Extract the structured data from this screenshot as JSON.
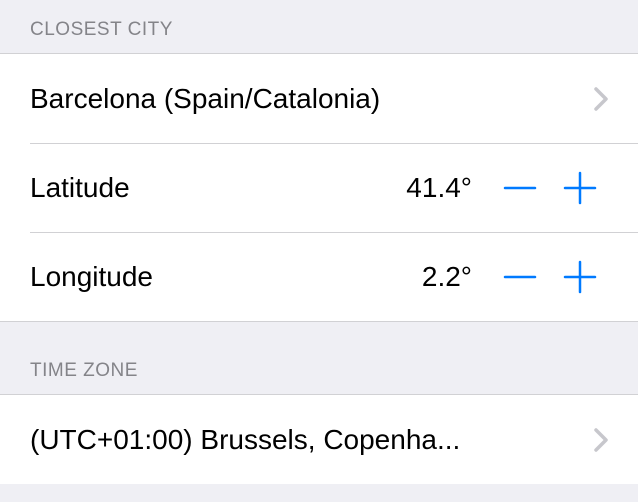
{
  "sections": {
    "closest_city": {
      "header": "Closest City",
      "city_value": "Barcelona (Spain/Catalonia)",
      "latitude_label": "Latitude",
      "latitude_value": "41.4°",
      "longitude_label": "Longitude",
      "longitude_value": "2.2°"
    },
    "time_zone": {
      "header": "Time Zone",
      "value": "(UTC+01:00) Brussels, Copenha..."
    }
  },
  "colors": {
    "accent": "#007aff",
    "chevron": "#c7c7cc"
  }
}
